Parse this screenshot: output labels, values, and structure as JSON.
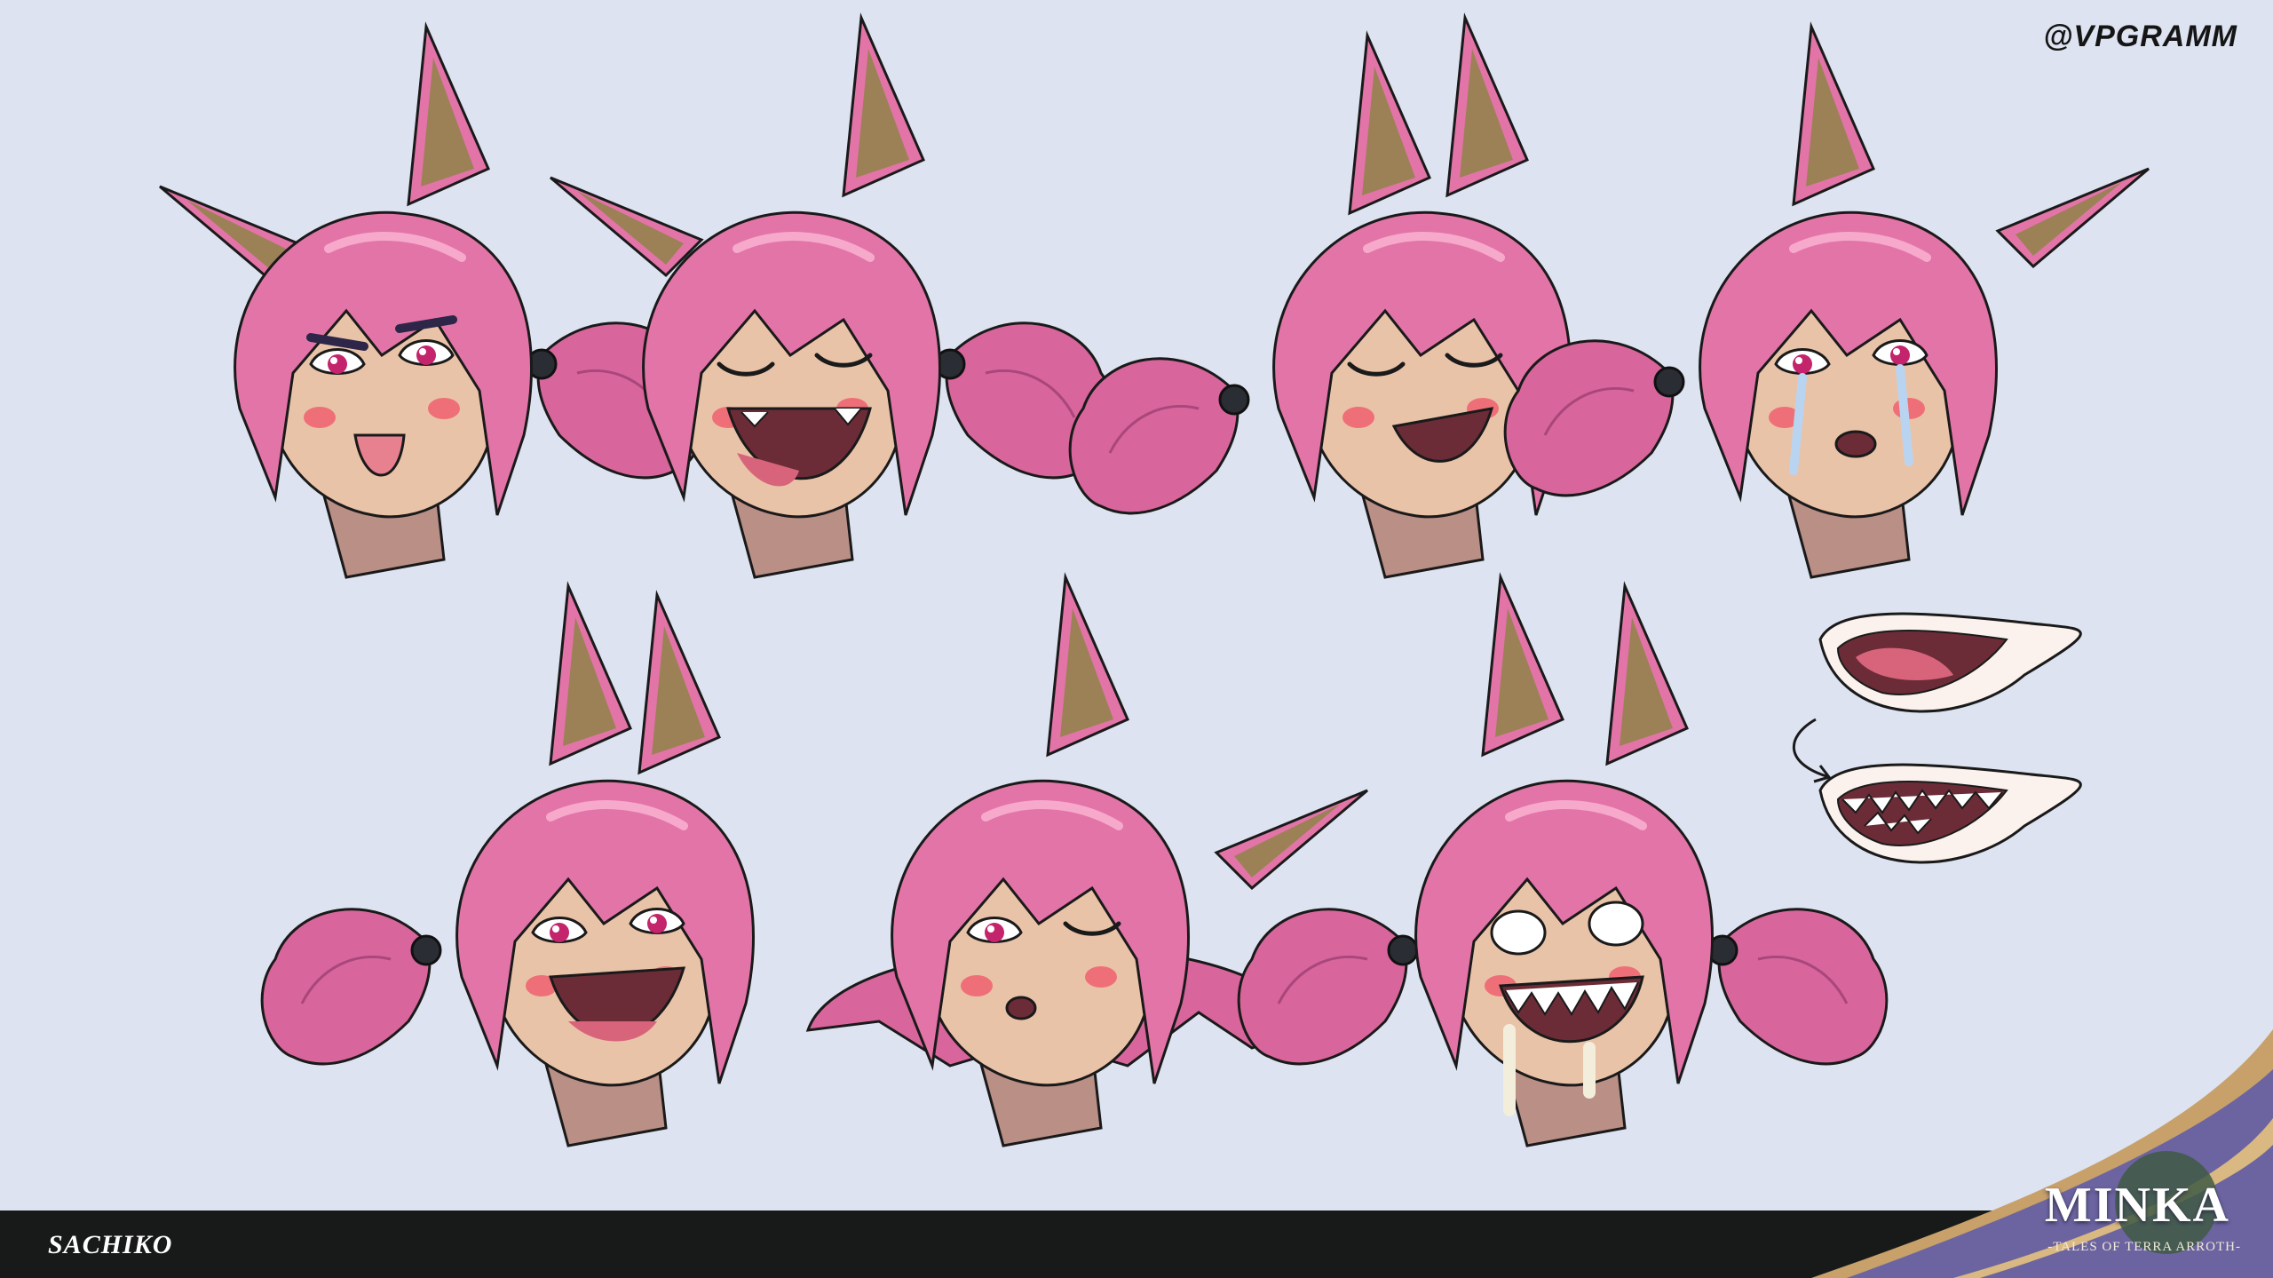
{
  "credit": "@VPGRAMM",
  "character_name": "SACHIKO",
  "logo": {
    "title": "MINKA",
    "subtitle": "-TALES OF TERRA ARROTH-"
  },
  "colors": {
    "background": "#dde3f1",
    "hair": "#e374a8",
    "hair_shadow": "#c65a8f",
    "ear_inner": "#9c8157",
    "skin": "#e9c3a8",
    "skin_shadow": "#b98f86",
    "blush": "#ef6f78",
    "bar": "#181a1a",
    "corner_purple": "#6c64a0",
    "corner_gold": "#c7a06a"
  },
  "expressions": [
    {
      "id": "tongue-out",
      "mood": "raspberry"
    },
    {
      "id": "laugh-tears",
      "mood": "laughing"
    },
    {
      "id": "smug-smile",
      "mood": "content"
    },
    {
      "id": "crying",
      "mood": "sad"
    },
    {
      "id": "excited",
      "mood": "happy"
    },
    {
      "id": "wink",
      "mood": "sleepy-wink"
    },
    {
      "id": "feral",
      "mood": "drooling-rage"
    }
  ],
  "mouth_studies": [
    {
      "id": "mouth-open"
    },
    {
      "id": "mouth-teeth"
    }
  ]
}
